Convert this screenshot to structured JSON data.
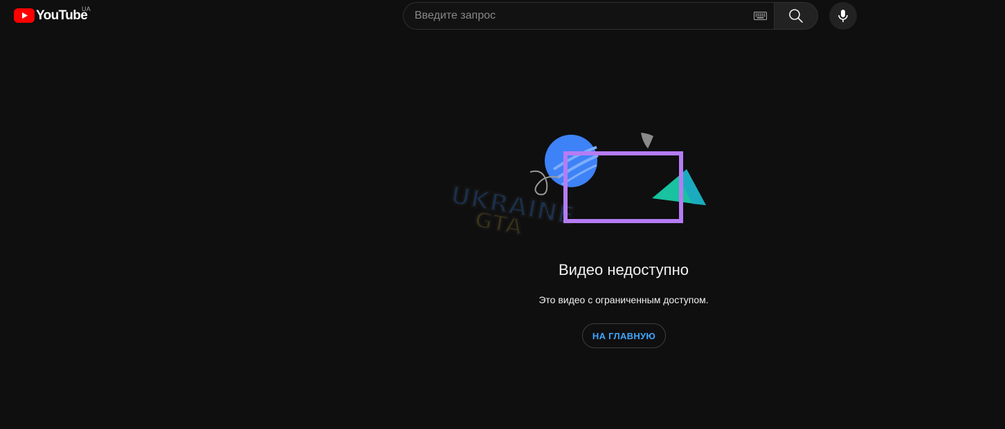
{
  "header": {
    "logo_text": "YouTube",
    "country_code": "UA",
    "logo_color": "#ff0000",
    "search": {
      "placeholder": "Введите запрос",
      "value": ""
    },
    "icons": {
      "keyboard": "keyboard-icon",
      "search": "search-icon",
      "mic": "mic-icon"
    }
  },
  "watermark": {
    "line1": "UKRAINE",
    "line2": "GTA"
  },
  "error": {
    "title": "Видео недоступно",
    "message": "Это видео с ограниченным доступом.",
    "home_button_label": "НА ГЛАВНУЮ"
  },
  "colors": {
    "background": "#0f0f0f",
    "accent_link": "#3ea6ff",
    "illustration_circle": "#3e82f7",
    "illustration_frame": "#b57cf4",
    "illustration_triangle": "#19c2a0"
  }
}
